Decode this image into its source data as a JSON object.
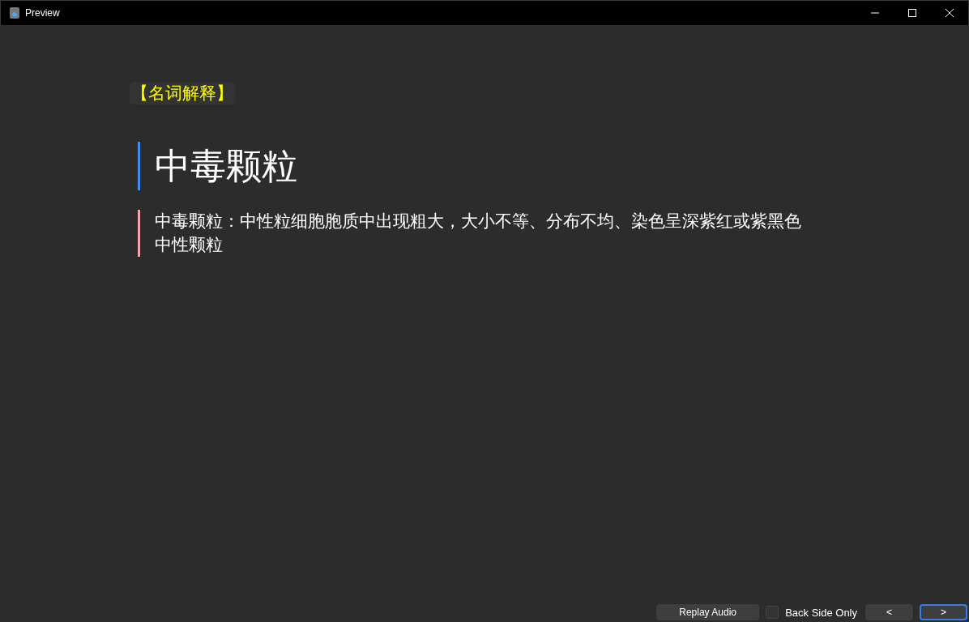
{
  "window": {
    "title": "Preview"
  },
  "card": {
    "tag": "【名词解释】",
    "heading": "中毒颗粒",
    "definition": "中毒颗粒：中性粒细胞胞质中出现粗大，大小不等、分布不均、染色呈深紫红或紫黑色中性颗粒"
  },
  "footer": {
    "replay_label": "Replay Audio",
    "back_side_only": {
      "label": "Back Side Only",
      "checked": false
    },
    "nav_buttons": [
      {
        "label": "<",
        "focused": false
      },
      {
        "label": ">",
        "focused": true
      }
    ]
  }
}
